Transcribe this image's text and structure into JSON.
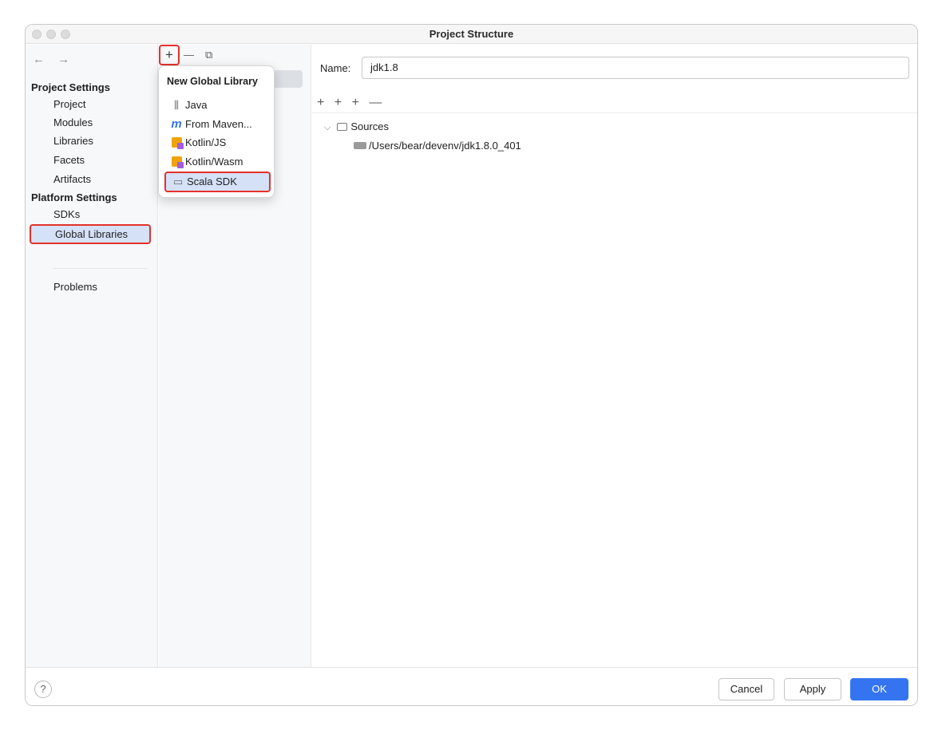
{
  "window": {
    "title": "Project Structure"
  },
  "sidebar": {
    "back_glyph": "←",
    "forward_glyph": "→",
    "project_settings_label": "Project Settings",
    "project_items": [
      "Project",
      "Modules",
      "Libraries",
      "Facets",
      "Artifacts"
    ],
    "platform_settings_label": "Platform Settings",
    "platform_items": [
      "SDKs",
      "Global Libraries"
    ],
    "selected_item": "Global Libraries",
    "problems_label": "Problems"
  },
  "toolbar": {
    "add_glyph": "+",
    "remove_glyph": "—",
    "copy_glyph": "⧉"
  },
  "popup": {
    "title": "New Global Library",
    "items": [
      {
        "label": "Java",
        "icon": "jar-icon"
      },
      {
        "label": "From Maven...",
        "icon": "maven-icon"
      },
      {
        "label": "Kotlin/JS",
        "icon": "kotlin-icon"
      },
      {
        "label": "Kotlin/Wasm",
        "icon": "kotlin-icon"
      },
      {
        "label": "Scala SDK",
        "icon": "scala-folder-icon"
      }
    ],
    "highlighted_item": "Scala SDK"
  },
  "detail": {
    "name_label": "Name:",
    "name_value": "jdk1.8",
    "toolbar_glyphs": [
      "+",
      "+",
      "+",
      "—"
    ],
    "tree": {
      "group": "Sources",
      "path": "/Users/bear/devenv/jdk1.8.0_401"
    }
  },
  "footer": {
    "help_label": "?",
    "cancel_label": "Cancel",
    "apply_label": "Apply",
    "ok_label": "OK"
  },
  "colors": {
    "accent": "#3574f0",
    "highlight_border": "#e4312b",
    "selection": "#d5e1f7"
  }
}
